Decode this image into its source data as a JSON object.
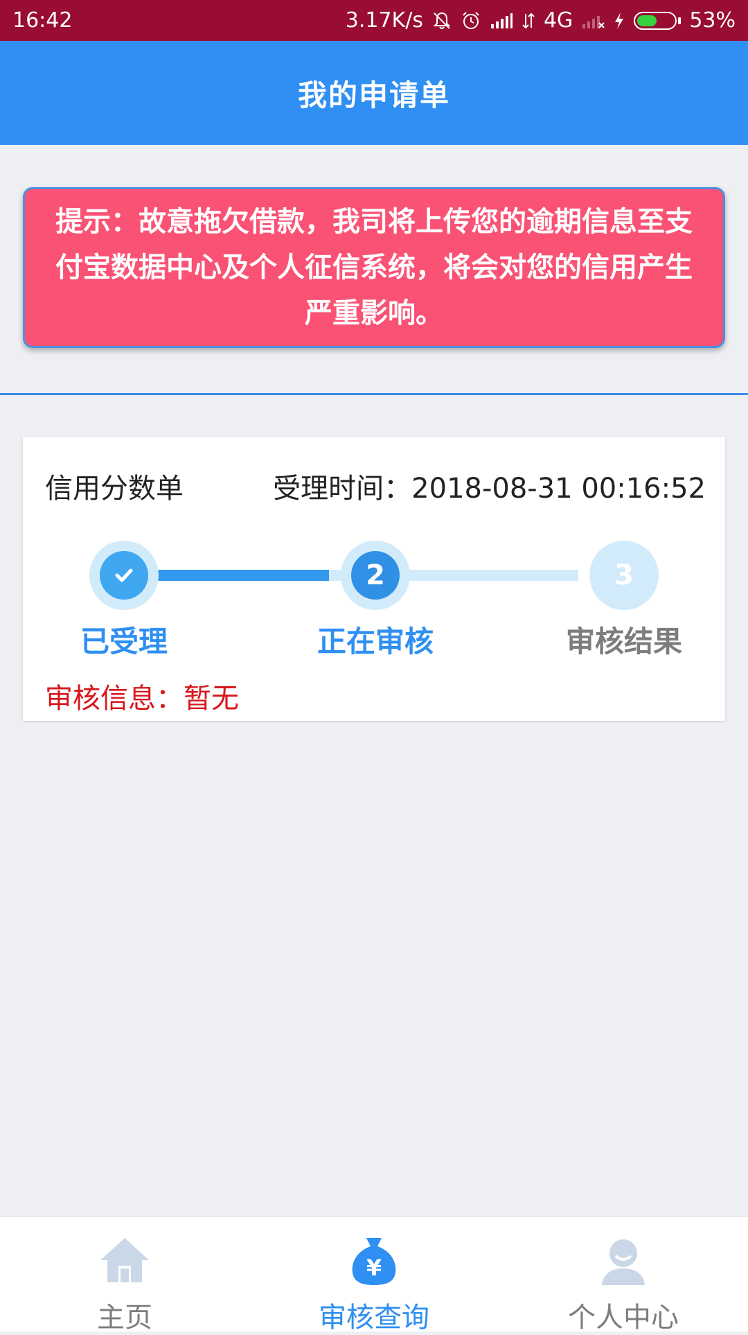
{
  "status_bar": {
    "time": "16:42",
    "network_speed": "3.17K/s",
    "network_type": "4G",
    "battery_percent": "53%",
    "battery_level": 0.53,
    "icons": [
      "mute-icon",
      "alarm-icon",
      "signal-icon",
      "data-arrows-icon",
      "signal-weak-icon",
      "charging-icon",
      "battery-icon"
    ]
  },
  "header": {
    "title": "我的申请单"
  },
  "warning": {
    "text": "提示：故意拖欠借款，我司将上传您的逾期信息至支付宝数据中心及个人征信系统，将会对您的信用产生严重影响。"
  },
  "card": {
    "title": "信用分数单",
    "time_label": "受理时间：2018-08-31 00:16:52",
    "steps": [
      {
        "number": "",
        "label": "已受理",
        "state": "done",
        "icon": "check-icon"
      },
      {
        "number": "2",
        "label": "正在审核",
        "state": "active"
      },
      {
        "number": "3",
        "label": "审核结果",
        "state": "pending"
      }
    ],
    "review_info": "审核信息：暂无"
  },
  "bottom_nav": {
    "items": [
      {
        "label": "主页",
        "icon": "home-icon",
        "active": false
      },
      {
        "label": "审核查询",
        "icon": "money-bag-icon",
        "active": true
      },
      {
        "label": "个人中心",
        "icon": "user-icon",
        "active": false
      }
    ]
  },
  "colors": {
    "status_bar": "#990d33",
    "header": "#2f8ff2",
    "warning_bg": "#fa5274",
    "review_text": "#d8171e",
    "inactive": "#7d7d7d"
  }
}
